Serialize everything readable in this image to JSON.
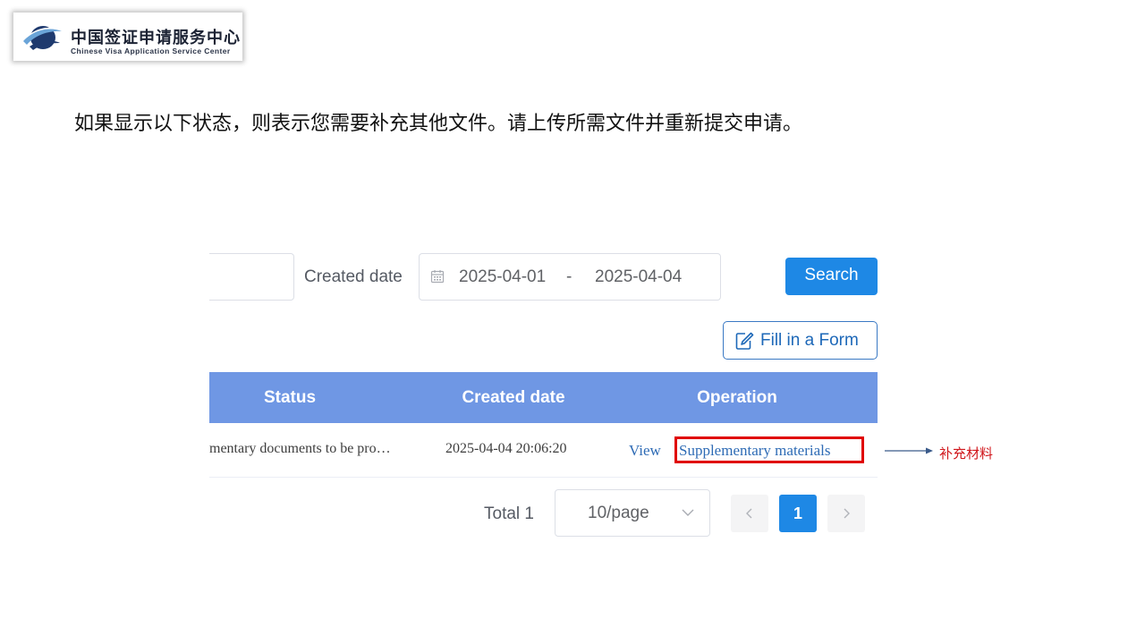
{
  "logo": {
    "title_cn": "中国签证申请服务中心",
    "title_en": "Chinese Visa Application Service Center"
  },
  "instruction": "如果显示以下状态，则表示您需要补充其他文件。请上传所需文件并重新提交申请。",
  "filters": {
    "created_label": "Created date",
    "date_start": "2025-04-01",
    "date_separator": "-",
    "date_end": "2025-04-04",
    "search_label": "Search",
    "fill_form_label": "Fill in a Form"
  },
  "table": {
    "headers": {
      "status": "Status",
      "created": "Created date",
      "operation": "Operation"
    },
    "rows": [
      {
        "status": "mentary documents to be pro…",
        "created": "2025-04-04 20:06:20",
        "view": "View",
        "supplementary": "Supplementary materials"
      }
    ]
  },
  "pagination": {
    "total": "Total 1",
    "page_size": "10/page",
    "current_page": "1"
  },
  "annotation": {
    "label": "补充材料",
    "color": "#e00000"
  },
  "colors": {
    "primary": "#1e88e5",
    "table_header": "#6f97e4",
    "link": "#2e6bb5"
  }
}
